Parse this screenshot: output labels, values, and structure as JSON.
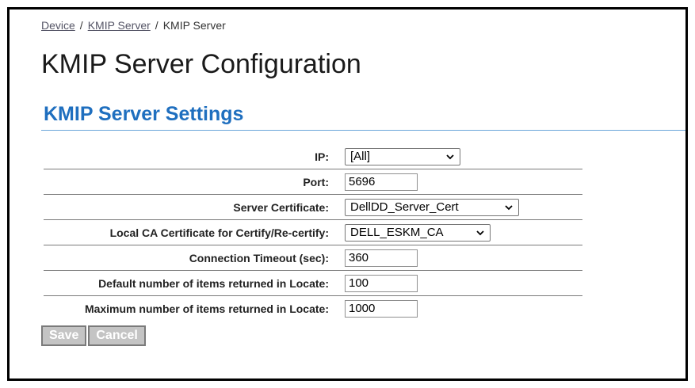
{
  "breadcrumb": {
    "items": [
      "Device",
      "KMIP Server",
      "KMIP Server"
    ],
    "separator": "/"
  },
  "page": {
    "title": "KMIP Server Configuration",
    "section_title": "KMIP Server Settings"
  },
  "settings": {
    "ip": {
      "label": "IP:",
      "value": "[All]"
    },
    "port": {
      "label": "Port:",
      "value": "5696"
    },
    "server_certificate": {
      "label": "Server Certificate:",
      "value": "DellDD_Server_Cert"
    },
    "local_ca_certificate": {
      "label": "Local CA Certificate for Certify/Re-certify:",
      "value": "DELL_ESKM_CA"
    },
    "connection_timeout": {
      "label": "Connection Timeout (sec):",
      "value": "360"
    },
    "default_items_locate": {
      "label": "Default number of items returned in Locate:",
      "value": "100"
    },
    "max_items_locate": {
      "label": "Maximum number of items returned in Locate:",
      "value": "1000"
    }
  },
  "buttons": {
    "save_label": "Save",
    "cancel_label": "Cancel"
  },
  "icons": {
    "dropdown": "chevron-down-icon"
  },
  "colors": {
    "section_title": "#1f6fbf",
    "disabled_button": "#c4c4c4"
  }
}
